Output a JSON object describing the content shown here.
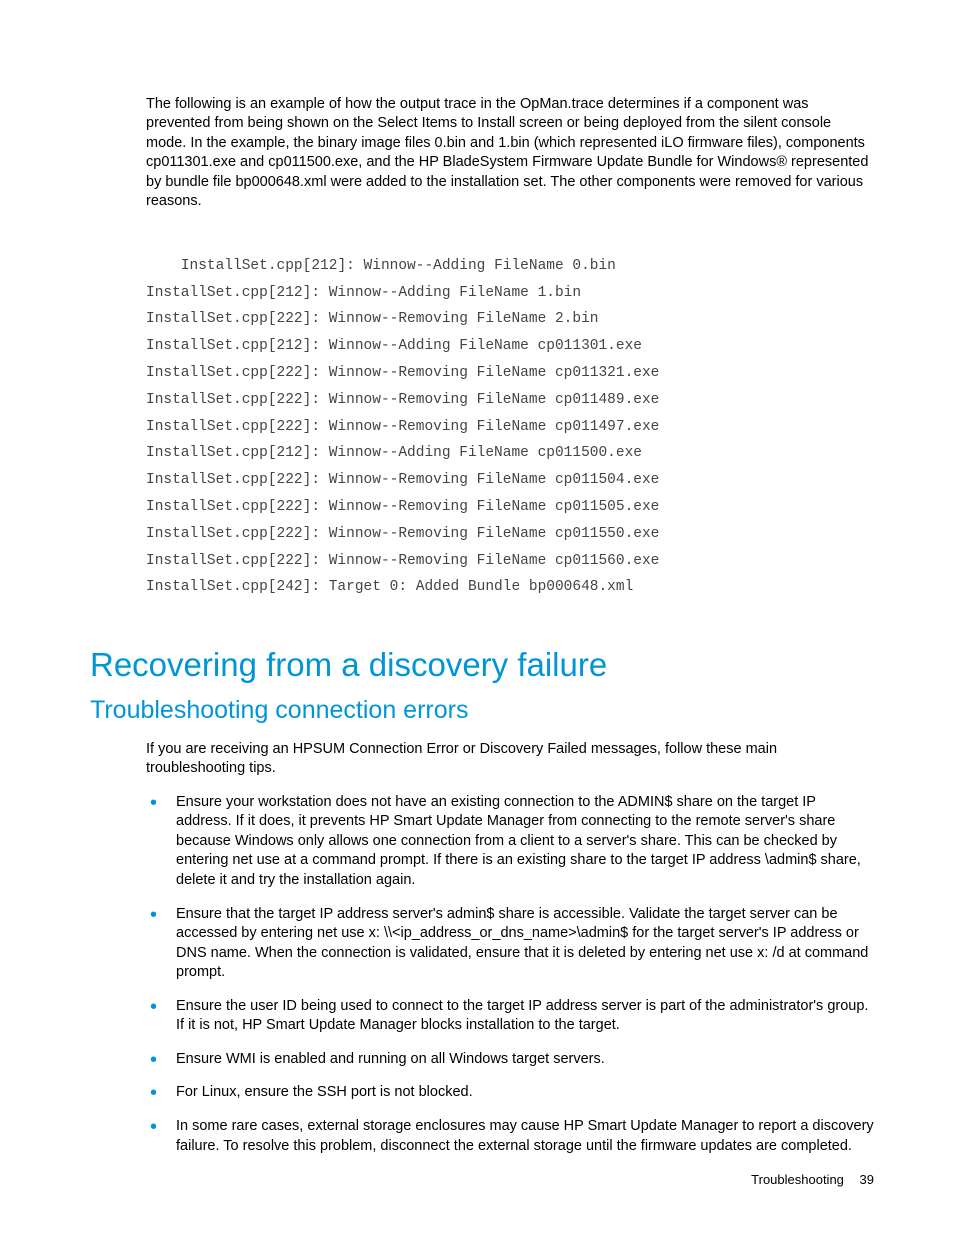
{
  "intro": "The following is an example of how the output trace in the OpMan.trace determines if a component was prevented from being shown on the Select Items to Install screen or being deployed from the silent console mode. In the example, the binary image files 0.bin and 1.bin (which represented iLO firmware files), components cp011301.exe and cp011500.exe, and the HP BladeSystem Firmware Update Bundle for Windows® represented by bundle file bp000648.xml were added to the installation set. The other components were removed for various reasons.",
  "code_lines": [
    "InstallSet.cpp[212]: Winnow--Adding FileName 0.bin",
    "InstallSet.cpp[212]: Winnow--Adding FileName 1.bin",
    "InstallSet.cpp[222]: Winnow--Removing FileName 2.bin",
    "InstallSet.cpp[212]: Winnow--Adding FileName cp011301.exe",
    "InstallSet.cpp[222]: Winnow--Removing FileName cp011321.exe",
    "InstallSet.cpp[222]: Winnow--Removing FileName cp011489.exe",
    "InstallSet.cpp[222]: Winnow--Removing FileName cp011497.exe",
    "InstallSet.cpp[212]: Winnow--Adding FileName cp011500.exe",
    "InstallSet.cpp[222]: Winnow--Removing FileName cp011504.exe",
    "InstallSet.cpp[222]: Winnow--Removing FileName cp011505.exe",
    "InstallSet.cpp[222]: Winnow--Removing FileName cp011550.exe",
    "InstallSet.cpp[222]: Winnow--Removing FileName cp011560.exe",
    "InstallSet.cpp[242]: Target 0: Added Bundle bp000648.xml"
  ],
  "heading1": "Recovering from a discovery failure",
  "heading2": "Troubleshooting connection errors",
  "para1": "If you are receiving an HPSUM Connection Error or Discovery Failed messages, follow these main troubleshooting tips.",
  "bullets": [
    "Ensure your workstation does not have an existing connection to the ADMIN$ share on the target IP address. If it does, it prevents HP Smart Update Manager from connecting to the remote server's share because Windows only allows one connection from a client to a server's share. This can be checked by entering net use at a command prompt. If there is an existing share to the target IP address \\admin$ share, delete it and try the installation again.",
    "Ensure that the target IP address server's admin$ share is accessible. Validate the target server can be accessed by entering net use x: \\\\<ip_address_or_dns_name>\\admin$ for the target server's IP address or DNS name. When the connection is validated, ensure that it is deleted by entering net use x: /d at command prompt.",
    "Ensure the user ID being used to connect to the target IP address server is part of the administrator's group. If it is not, HP Smart Update Manager blocks installation to the target.",
    "Ensure WMI is enabled and running on all Windows target servers.",
    "For Linux, ensure the SSH port is not blocked.",
    "In some rare cases, external storage enclosures may cause HP Smart Update Manager to report a discovery failure. To resolve this problem, disconnect the external storage until the firmware updates are completed."
  ],
  "footer": {
    "section": "Troubleshooting",
    "page": "39"
  }
}
